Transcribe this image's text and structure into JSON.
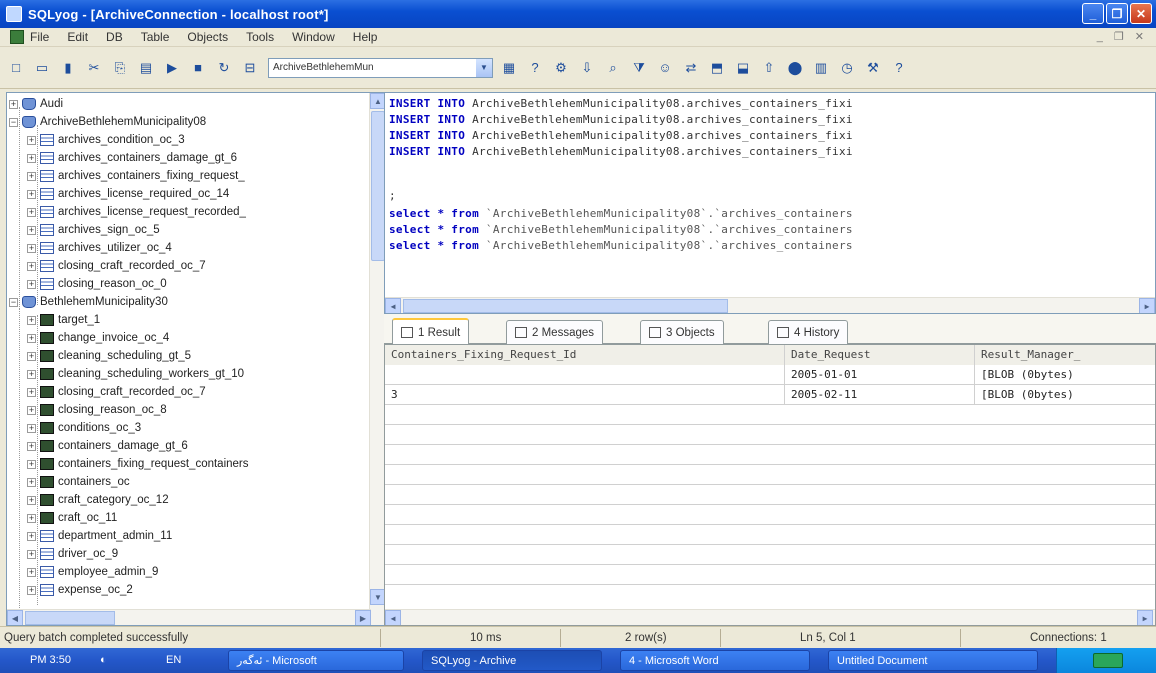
{
  "window": {
    "title": "SQLyog - [ArchiveConnection - localhost root*]"
  },
  "menu": {
    "items": [
      "File",
      "Edit",
      "DB",
      "Table",
      "Objects",
      "Tools",
      "Window",
      "Help"
    ]
  },
  "toolbar": {
    "db_selector_value": "ArchiveBethlehemMun"
  },
  "tree": {
    "items": [
      {
        "label": "Audi",
        "level": 0,
        "icon": "db",
        "expander": "+"
      },
      {
        "label": "ArchiveBethlehemMunicipality08",
        "level": 0,
        "icon": "db",
        "expander": "-"
      },
      {
        "label": "archives_condition_oc_3",
        "level": 1,
        "icon": "table",
        "expander": "+"
      },
      {
        "label": "archives_containers_damage_gt_6",
        "level": 1,
        "icon": "table",
        "expander": "+"
      },
      {
        "label": "archives_containers_fixing_request_",
        "level": 1,
        "icon": "table",
        "expander": "+"
      },
      {
        "label": "archives_license_required_oc_14",
        "level": 1,
        "icon": "table",
        "expander": "+"
      },
      {
        "label": "archives_license_request_recorded_",
        "level": 1,
        "icon": "table",
        "expander": "+"
      },
      {
        "label": "archives_sign_oc_5",
        "level": 1,
        "icon": "table",
        "expander": "+"
      },
      {
        "label": "archives_utilizer_oc_4",
        "level": 1,
        "icon": "table",
        "expander": "+"
      },
      {
        "label": "closing_craft_recorded_oc_7",
        "level": 1,
        "icon": "table",
        "expander": "+"
      },
      {
        "label": "closing_reason_oc_0",
        "level": 1,
        "icon": "table",
        "expander": "+"
      },
      {
        "label": "BethlehemMunicipality30",
        "level": 0,
        "icon": "db",
        "expander": "-"
      },
      {
        "label": "target_1",
        "level": 1,
        "icon": "dark",
        "expander": "+"
      },
      {
        "label": "change_invoice_oc_4",
        "level": 1,
        "icon": "dark",
        "expander": "+"
      },
      {
        "label": "cleaning_scheduling_gt_5",
        "level": 1,
        "icon": "dark",
        "expander": "+"
      },
      {
        "label": "cleaning_scheduling_workers_gt_10",
        "level": 1,
        "icon": "dark",
        "expander": "+"
      },
      {
        "label": "closing_craft_recorded_oc_7",
        "level": 1,
        "icon": "dark",
        "expander": "+"
      },
      {
        "label": "closing_reason_oc_8",
        "level": 1,
        "icon": "dark",
        "expander": "+"
      },
      {
        "label": "conditions_oc_3",
        "level": 1,
        "icon": "dark",
        "expander": "+"
      },
      {
        "label": "containers_damage_gt_6",
        "level": 1,
        "icon": "dark",
        "expander": "+"
      },
      {
        "label": "containers_fixing_request_containers",
        "level": 1,
        "icon": "dark",
        "expander": "+"
      },
      {
        "label": "containers_oc",
        "level": 1,
        "icon": "dark",
        "expander": "+"
      },
      {
        "label": "craft_category_oc_12",
        "level": 1,
        "icon": "dark",
        "expander": "+"
      },
      {
        "label": "craft_oc_11",
        "level": 1,
        "icon": "dark",
        "expander": "+"
      },
      {
        "label": "department_admin_11",
        "level": 1,
        "icon": "table",
        "expander": "+"
      },
      {
        "label": "driver_oc_9",
        "level": 1,
        "icon": "table",
        "expander": "+"
      },
      {
        "label": "employee_admin_9",
        "level": 1,
        "icon": "table",
        "expander": "+"
      },
      {
        "label": "expense_oc_2",
        "level": 1,
        "icon": "table",
        "expander": "+"
      }
    ]
  },
  "editor": {
    "lines": [
      {
        "keyword": "INSERT INTO",
        "text": " ArchiveBethlehemMunicipality08.archives_containers_fixi",
        "kind": "insert"
      },
      {
        "keyword": "INSERT INTO",
        "text": " ArchiveBethlehemMunicipality08.archives_containers_fixi",
        "kind": "insert"
      },
      {
        "keyword": "INSERT INTO",
        "text": " ArchiveBethlehemMunicipality08.archives_containers_fixi",
        "kind": "insert"
      },
      {
        "keyword": "INSERT INTO",
        "text": " ArchiveBethlehemMunicipality08.archives_containers_fixi",
        "kind": "insert"
      },
      {
        "keyword": "",
        "text": ";",
        "kind": "plain"
      },
      {
        "keyword": "select * from",
        "text": " `ArchiveBethlehemMunicipality08`.`archives_containers",
        "kind": "select"
      },
      {
        "keyword": "select * from",
        "text": " `ArchiveBethlehemMunicipality08`.`archives_containers",
        "kind": "select"
      },
      {
        "keyword": "select * from",
        "text": " `ArchiveBethlehemMunicipality08`.`archives_containers",
        "kind": "select"
      }
    ]
  },
  "tabs": [
    {
      "label": "1 Result",
      "active": true
    },
    {
      "label": "2 Messages",
      "active": false
    },
    {
      "label": "3 Objects",
      "active": false
    },
    {
      "label": "4 History",
      "active": false
    }
  ],
  "grid": {
    "columns": [
      "Containers_Fixing_Request_Id",
      "Date_Request",
      "Result_Manager_"
    ],
    "rows": [
      [
        "",
        "2005-01-01",
        "[BLOB (0bytes)"
      ],
      [
        "3",
        "2005-02-11",
        "[BLOB (0bytes)"
      ]
    ]
  },
  "status": {
    "message": "Query batch completed successfully",
    "time": "10 ms",
    "rows": "2 row(s)",
    "position": "Ln 5, Col 1",
    "connections": "Connections: 1"
  },
  "taskbar": {
    "clock": "PM 3:50",
    "lang": "EN",
    "items": [
      "ئەگەر - Microsoft",
      "SQLyog - Archive",
      "4 - Microsoft Word",
      "Untitled Document"
    ]
  }
}
